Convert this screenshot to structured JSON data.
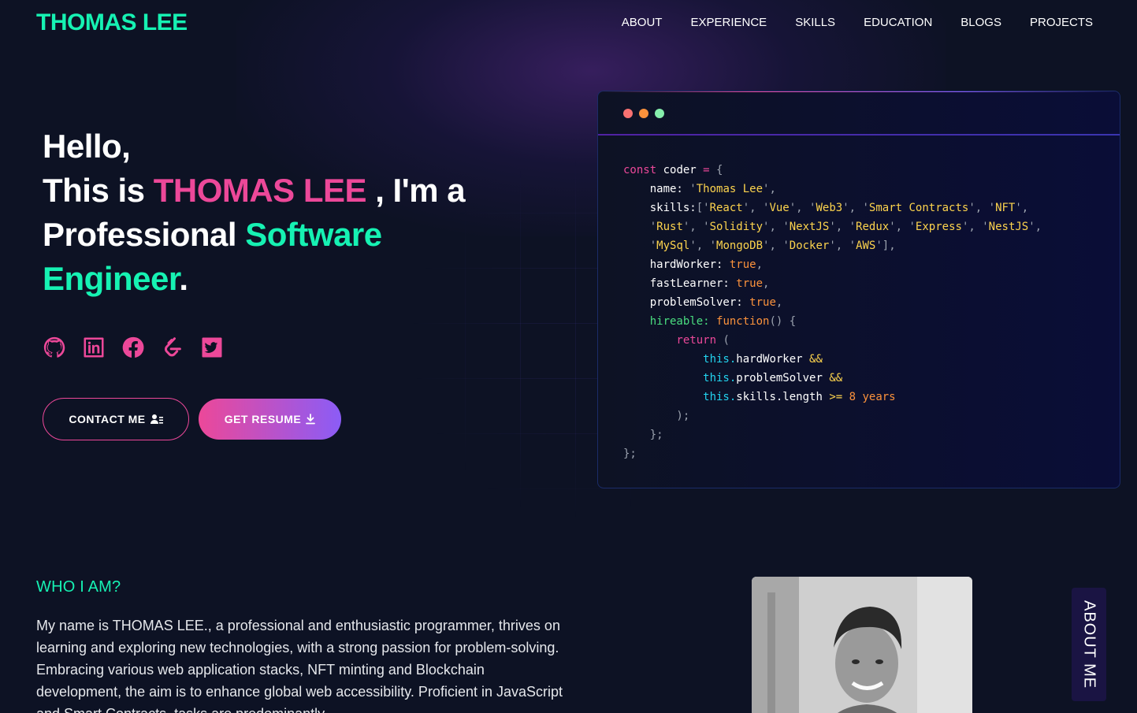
{
  "header": {
    "logo": "THOMAS LEE",
    "nav": [
      "ABOUT",
      "EXPERIENCE",
      "SKILLS",
      "EDUCATION",
      "BLOGS",
      "PROJECTS"
    ]
  },
  "hero": {
    "line1": "Hello,",
    "line2_prefix": "This is ",
    "name": "THOMAS LEE",
    "line2_suffix": " , I'm a",
    "line3_prefix": "Professional ",
    "role_word1": "Software",
    "role_word2": "Engineer",
    "period": ".",
    "socials": [
      "github-icon",
      "linkedin-icon",
      "facebook-icon",
      "leetcode-icon",
      "twitter-icon"
    ],
    "contact_label": "CONTACT ME",
    "resume_label": "GET RESUME"
  },
  "code_window": {
    "dot_colors": [
      "#f87171",
      "#fb923c",
      "#86efac"
    ],
    "lines": [
      [
        [
          "k",
          "const"
        ],
        [
          "w",
          " coder "
        ],
        [
          "k",
          "="
        ],
        [
          "g",
          " {"
        ]
      ],
      [
        [
          "w",
          "    name: "
        ],
        [
          "g",
          "'"
        ],
        [
          "a",
          "Thomas Lee"
        ],
        [
          "g",
          "',"
        ]
      ],
      [
        [
          "w",
          "    skills:"
        ],
        [
          "g",
          "['"
        ],
        [
          "a",
          "React"
        ],
        [
          "g",
          "', '"
        ],
        [
          "a",
          "Vue"
        ],
        [
          "g",
          "', '"
        ],
        [
          "a",
          "Web3"
        ],
        [
          "g",
          "', '"
        ],
        [
          "a",
          "Smart Contracts"
        ],
        [
          "g",
          "', '"
        ],
        [
          "a",
          "NFT"
        ],
        [
          "g",
          "',"
        ]
      ],
      [
        [
          "g",
          "    '"
        ],
        [
          "a",
          "Rust"
        ],
        [
          "g",
          "', '"
        ],
        [
          "a",
          "Solidity"
        ],
        [
          "g",
          "', '"
        ],
        [
          "a",
          "NextJS"
        ],
        [
          "g",
          "', '"
        ],
        [
          "a",
          "Redux"
        ],
        [
          "g",
          "', '"
        ],
        [
          "a",
          "Express"
        ],
        [
          "g",
          "', '"
        ],
        [
          "a",
          "NestJS"
        ],
        [
          "g",
          "',"
        ]
      ],
      [
        [
          "g",
          "    '"
        ],
        [
          "a",
          "MySql"
        ],
        [
          "g",
          "', '"
        ],
        [
          "a",
          "MongoDB"
        ],
        [
          "g",
          "', '"
        ],
        [
          "a",
          "Docker"
        ],
        [
          "g",
          "', '"
        ],
        [
          "a",
          "AWS"
        ],
        [
          "g",
          "'],"
        ]
      ],
      [
        [
          "w",
          "    hardWorker: "
        ],
        [
          "o",
          "true"
        ],
        [
          "g",
          ","
        ]
      ],
      [
        [
          "w",
          "    fastLearner: "
        ],
        [
          "o",
          "true"
        ],
        [
          "g",
          ","
        ]
      ],
      [
        [
          "w",
          "    problemSolver: "
        ],
        [
          "o",
          "true"
        ],
        [
          "g",
          ","
        ]
      ],
      [
        [
          "n",
          "    hireable: "
        ],
        [
          "o",
          "function"
        ],
        [
          "g",
          "() {"
        ]
      ],
      [
        [
          "k",
          "        return"
        ],
        [
          "g",
          " ("
        ]
      ],
      [
        [
          "c",
          "            this."
        ],
        [
          "w",
          "hardWorker "
        ],
        [
          "a",
          "&&"
        ]
      ],
      [
        [
          "c",
          "            this."
        ],
        [
          "w",
          "problemSolver "
        ],
        [
          "a",
          "&&"
        ]
      ],
      [
        [
          "c",
          "            this."
        ],
        [
          "w",
          "skills.length "
        ],
        [
          "a",
          ">="
        ],
        [
          "o",
          " 8 years"
        ]
      ],
      [
        [
          "g",
          "        );"
        ]
      ],
      [
        [
          "g",
          "    };"
        ]
      ],
      [
        [
          "g",
          "};"
        ]
      ]
    ]
  },
  "about": {
    "title": "WHO I AM?",
    "paragraph": "My name is THOMAS LEE., a professional and enthusiastic programmer, thrives on learning and exploring new technologies, with a strong passion for problem-solving. Embracing various web application stacks, NFT minting and Blockchain development, the aim is to enhance global web accessibility. Proficient in JavaScript and Smart Contracts, tasks are predominantly",
    "tab_label": "ABOUT ME"
  }
}
